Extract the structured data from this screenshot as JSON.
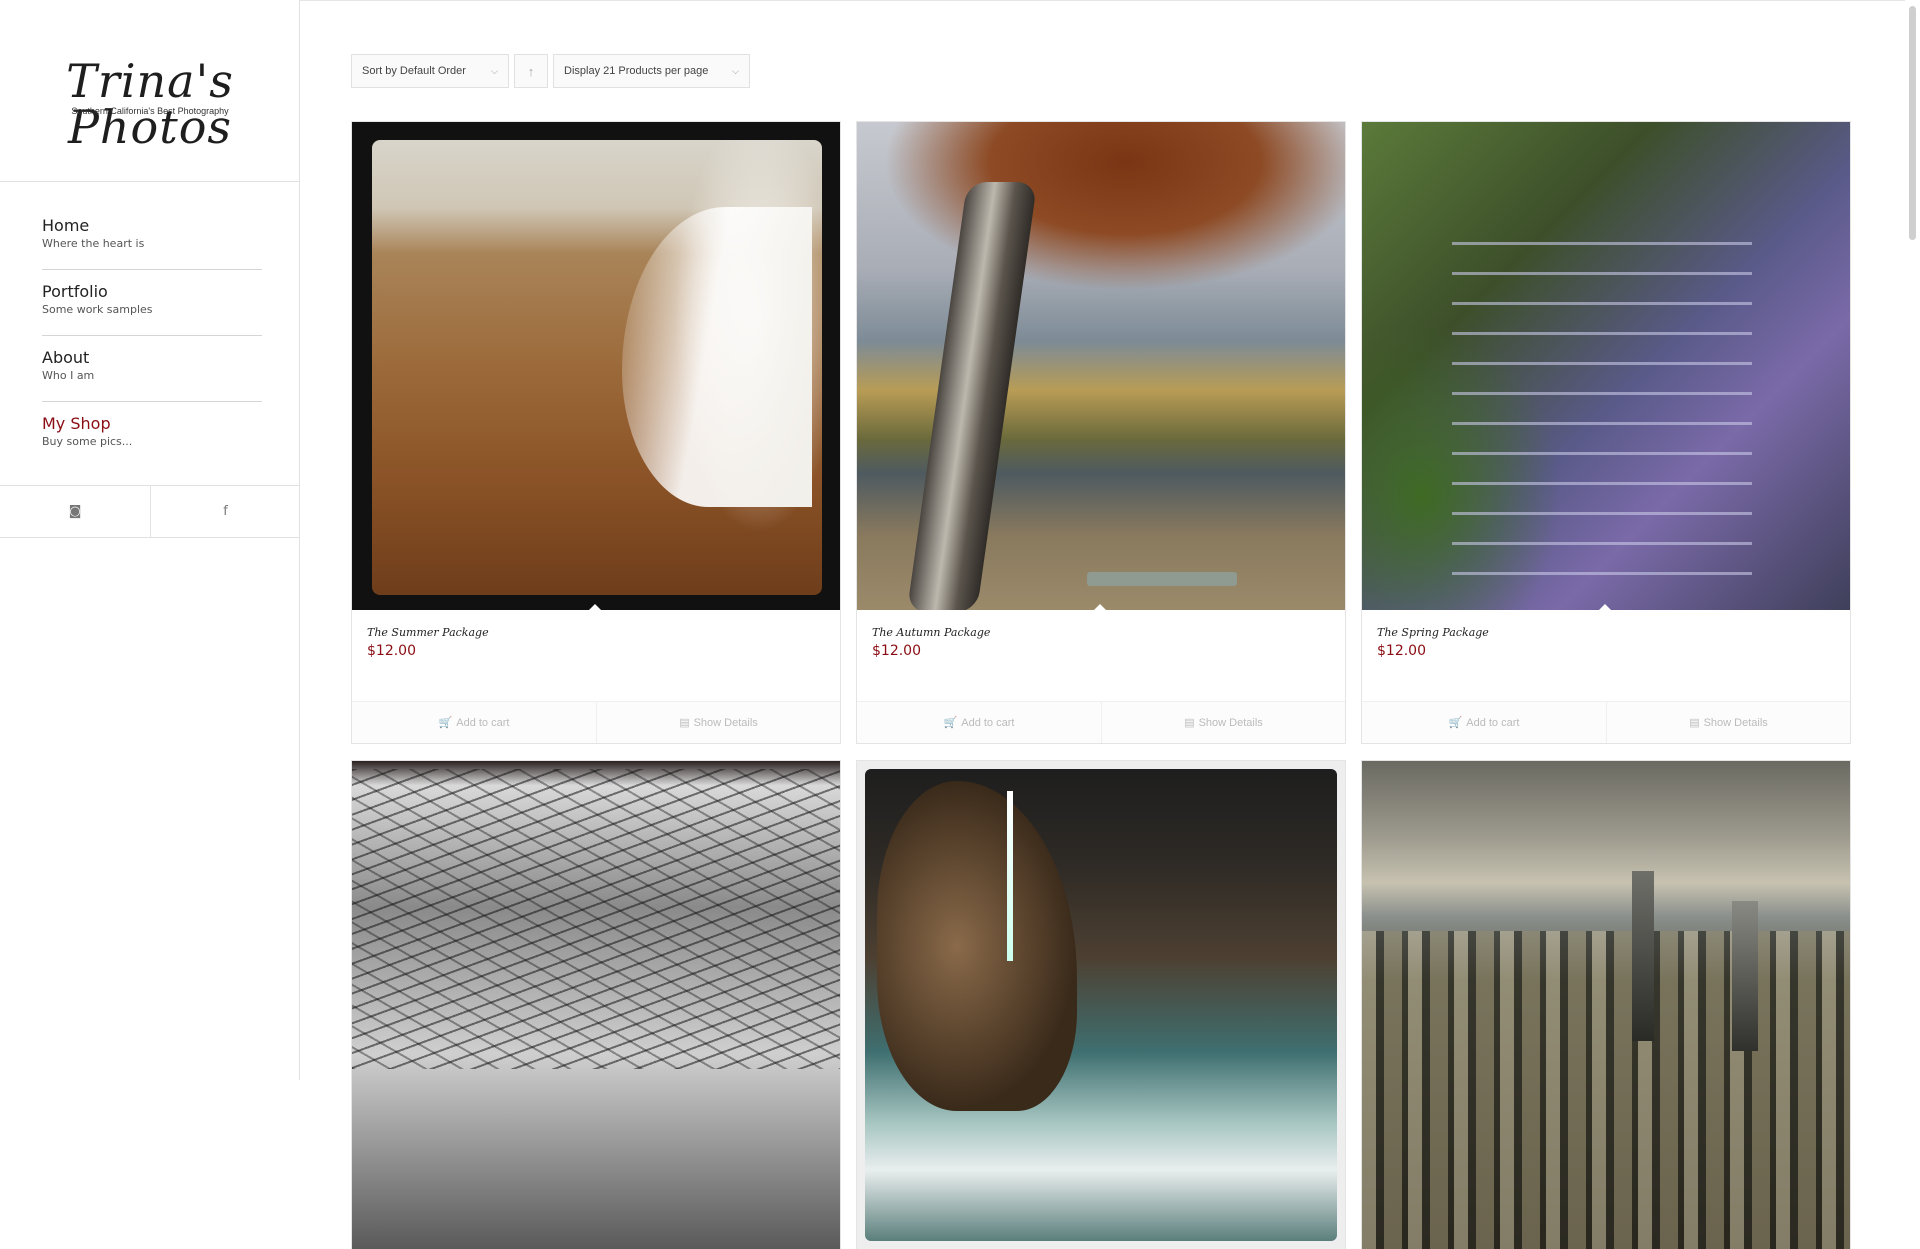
{
  "logo": {
    "title": "Trina's Photos",
    "tagline": "Southern California's Best Photography"
  },
  "nav": {
    "items": [
      {
        "label": "Home",
        "desc": "Where the heart is"
      },
      {
        "label": "Portfolio",
        "desc": "Some work samples"
      },
      {
        "label": "About",
        "desc": "Who I am"
      },
      {
        "label": "My Shop",
        "desc": "Buy some pics..."
      }
    ],
    "active_index": 3
  },
  "social": {
    "instagram_icon": "instagram-icon",
    "instagram_glyph": "◙",
    "facebook_icon": "facebook-icon",
    "facebook_glyph": "f"
  },
  "controls": {
    "sort_label": "Sort by Default Order",
    "direction_glyph": "↑",
    "count_label": "Display 21 Products per page",
    "chevron_glyph": "⌵"
  },
  "products": [
    {
      "title": "The Summer Package",
      "price": "$12.00",
      "add_to_cart": "Add to cart",
      "show_details": "Show Details"
    },
    {
      "title": "The Autumn Package",
      "price": "$12.00",
      "add_to_cart": "Add to cart",
      "show_details": "Show Details"
    },
    {
      "title": "The Spring Package",
      "price": "$12.00",
      "add_to_cart": "Add to cart",
      "show_details": "Show Details"
    }
  ],
  "icons": {
    "cart_glyph": "🛒",
    "details_glyph": "▤"
  },
  "colors": {
    "accent": "#8b0d14",
    "border": "#e1e1e1"
  }
}
